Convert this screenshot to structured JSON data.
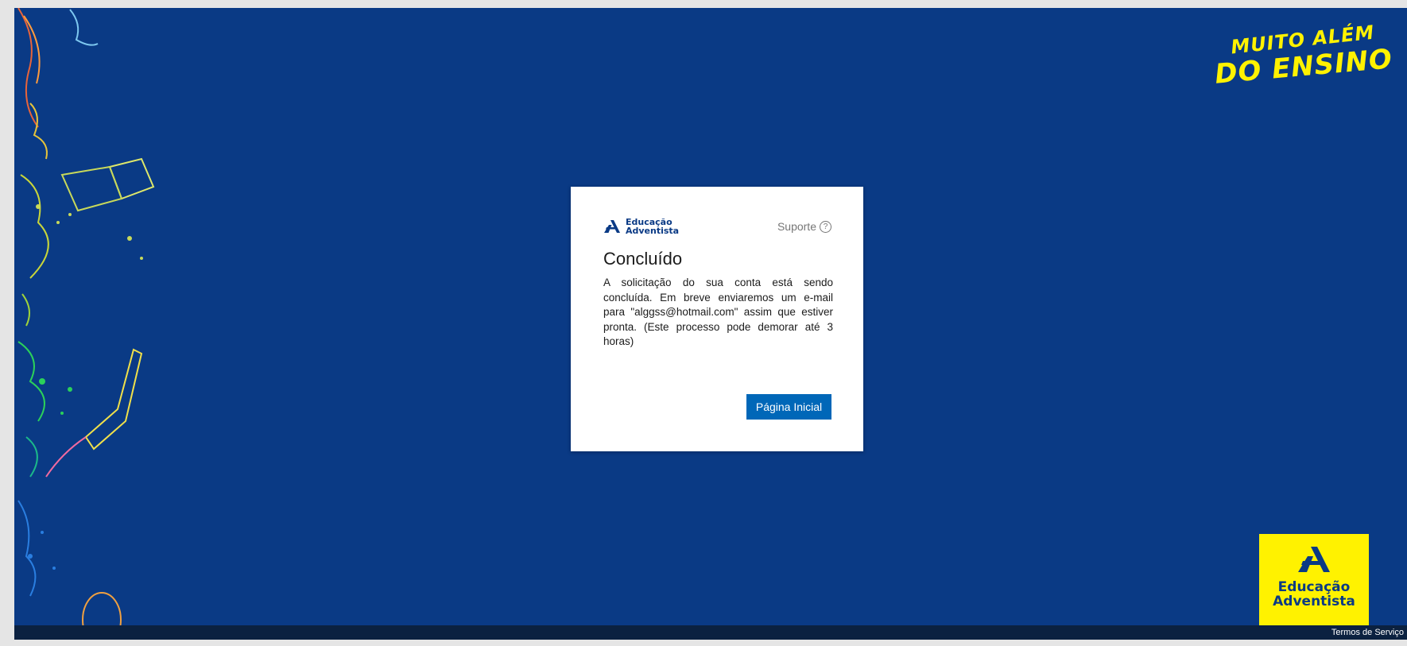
{
  "card": {
    "logo_line1": "Educação",
    "logo_line2": "Adventista",
    "support_label": "Suporte",
    "title": "Concluído",
    "message": "A solicitação do sua conta está sendo concluída. Em breve enviaremos um e-mail para \"alggss@hotmail.com\" assim que estiver pronta. (Este processo pode demorar até 3 horas)",
    "home_button_label": "Página Inicial"
  },
  "slogan": {
    "line1": "MUITO ALÉM",
    "line2": "DO ENSINO"
  },
  "brand_badge": {
    "line1": "Educação",
    "line2": "Adventista"
  },
  "footer": {
    "terms_link": "Termos de Serviço"
  },
  "colors": {
    "background": "#0a3a85",
    "badge_yellow": "#fff200",
    "button_blue": "#0067b8",
    "footer_dark": "#0b2140"
  },
  "icons": {
    "brand_logo": "educacao-adventista-logo-icon",
    "help": "question-circle-icon"
  }
}
